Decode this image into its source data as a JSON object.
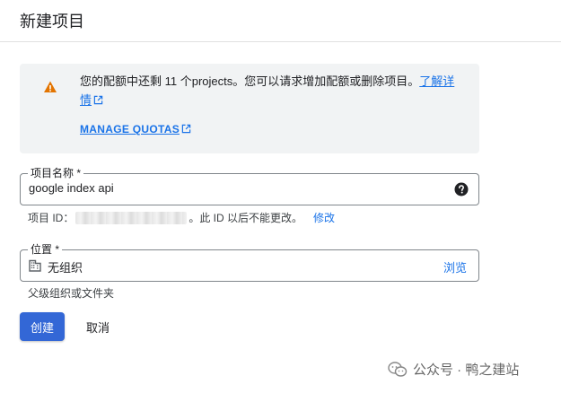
{
  "header": {
    "title": "新建项目"
  },
  "quota": {
    "message": "您的配额中还剩 11 个projects。您可以请求增加配额或删除项目。",
    "learn_more": "了解详情",
    "manage_label": "MANAGE QUOTAS",
    "warning_color": "#e37400"
  },
  "project_name": {
    "label": "项目名称 *",
    "value": "google index api"
  },
  "project_id": {
    "prefix": "项目 ID：",
    "suffix": "。此 ID 以后不能更改。",
    "edit_label": "修改"
  },
  "location": {
    "label": "位置 *",
    "value": "无组织",
    "browse_label": "浏览",
    "hint": "父级组织或文件夹"
  },
  "actions": {
    "create_label": "创建",
    "cancel_label": "取消",
    "primary_color": "#3367d6"
  },
  "watermark": {
    "text": "公众号 · 鸭之建站"
  }
}
